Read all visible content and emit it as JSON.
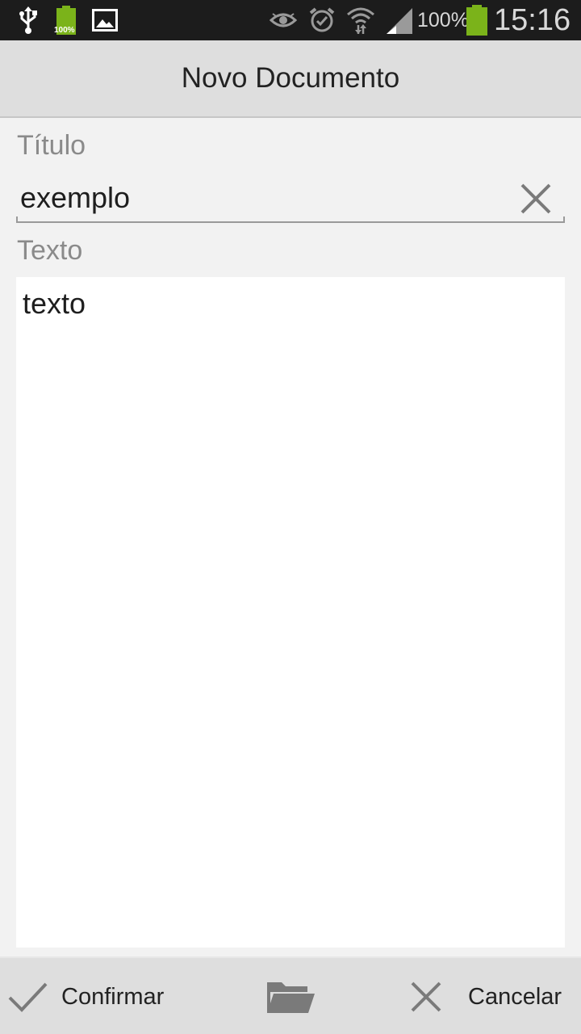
{
  "status_bar": {
    "battery_percent": "100%",
    "time": "15:16",
    "icons": [
      "usb-icon",
      "battery-full-notification-icon",
      "image-icon",
      "eye-icon",
      "alarm-icon",
      "wifi-icon",
      "signal-icon",
      "battery-icon"
    ],
    "notification_battery_label": "100%"
  },
  "action_bar": {
    "title": "Novo Documento"
  },
  "form": {
    "title_label": "Título",
    "title_value": "exemplo",
    "text_label": "Texto",
    "text_value": "texto"
  },
  "bottom_bar": {
    "confirm_label": "Confirmar",
    "open_icon": "folder-icon",
    "cancel_label": "Cancelar"
  },
  "colors": {
    "status_bar_bg": "#1c1c1c",
    "action_bar_bg": "#dedede",
    "content_bg": "#f2f2f2",
    "battery_green": "#7bb31a"
  }
}
